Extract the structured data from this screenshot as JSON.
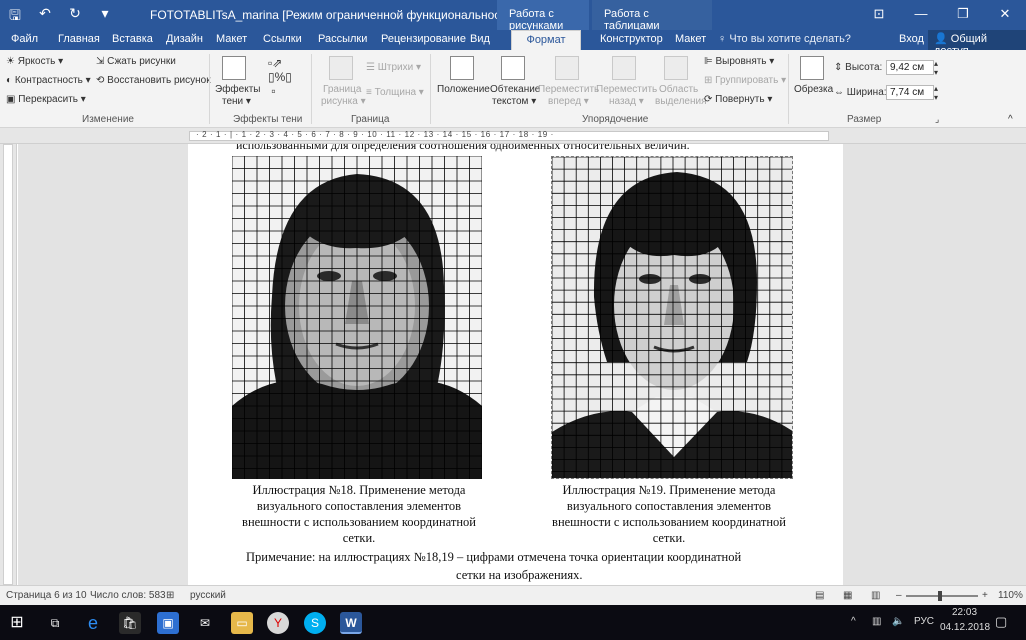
{
  "window": {
    "title": "FOTOTABLITsA_marina [Режим ограниченной функциональности] - Word",
    "context_tab_pictures": "Работа с рисунками",
    "context_tab_tables": "Работа с таблицами",
    "controls": [
      "⊡",
      "—",
      "❐",
      "✕"
    ]
  },
  "qat": {
    "save": "🖫",
    "undo": "↶",
    "redo": "↻",
    "more": "▾"
  },
  "tabs": [
    "Файл",
    "Главная",
    "Вставка",
    "Дизайн",
    "Макет",
    "Ссылки",
    "Рассылки",
    "Рецензирование",
    "Вид",
    "Формат",
    "Конструктор",
    "Макет"
  ],
  "active_tab": "Формат",
  "tell_me": "Что вы хотите сделать?",
  "sign_in": "Вход",
  "share": "Общий доступ",
  "ribbon": {
    "change": {
      "brightness": "Яркость ▾",
      "contrast": "Контрастность ▾",
      "recolor": "Перекрасить ▾",
      "compress": "Сжать рисунки",
      "reset": "Восстановить рисунок",
      "label": "Изменение"
    },
    "shadow": {
      "effects": "Эффекты",
      "effects2": "тени ▾",
      "label": "Эффекты тени"
    },
    "border": {
      "border1": "Граница",
      "border2": "рисунка ▾",
      "dashes": "Штрихи ▾",
      "weight": "Толщина ▾",
      "label": "Граница"
    },
    "arrange": {
      "position": "Положение",
      "wrap1": "Обтекание",
      "wrap2": "текстом ▾",
      "forward1": "Переместить",
      "forward2": "вперед ▾",
      "backward1": "Переместить",
      "backward2": "назад ▾",
      "pane1": "Область",
      "pane2": "выделения",
      "align": "Выровнять ▾",
      "group": "Группировать ▾",
      "rotate": "Повернуть ▾",
      "label": "Упорядочение"
    },
    "size": {
      "crop": "Обрезка",
      "height_label": "Высота:",
      "height_value": "9,42 см",
      "width_label": "Ширина:",
      "width_value": "7,74 см",
      "label": "Размер"
    }
  },
  "ruler": "· 2 · 1 · | · 1 · 2 · 3 · 4 · 5 · 6 · 7 · 8 · 9 · 10 · 11 · 12 · 13 · 14 · 15 · 16 · 17 · 18 · 19 ·",
  "document": {
    "top_text": "использованными для определения соотношения одноименных относительных величин.",
    "caption1": "Иллюстрация №18. Применение метода визуального сопоставления элементов внешности с использованием координатной сетки.",
    "caption2": "Иллюстрация №19. Применение метода визуального сопоставления элементов внешности с использованием координатной сетки.",
    "note1": "Примечание: на иллюстрациях №18,19 – цифрами     отмечена точка ориентации координатной",
    "note2": "сетки на изображениях."
  },
  "status": {
    "page": "Страница 6 из 10",
    "words": "Число слов: 583",
    "language": "русский",
    "zoom": "110%",
    "zoom_fraction": 0.47
  },
  "taskbar": {
    "lang": "РУС",
    "time": "22:03",
    "date": "04.12.2018"
  }
}
